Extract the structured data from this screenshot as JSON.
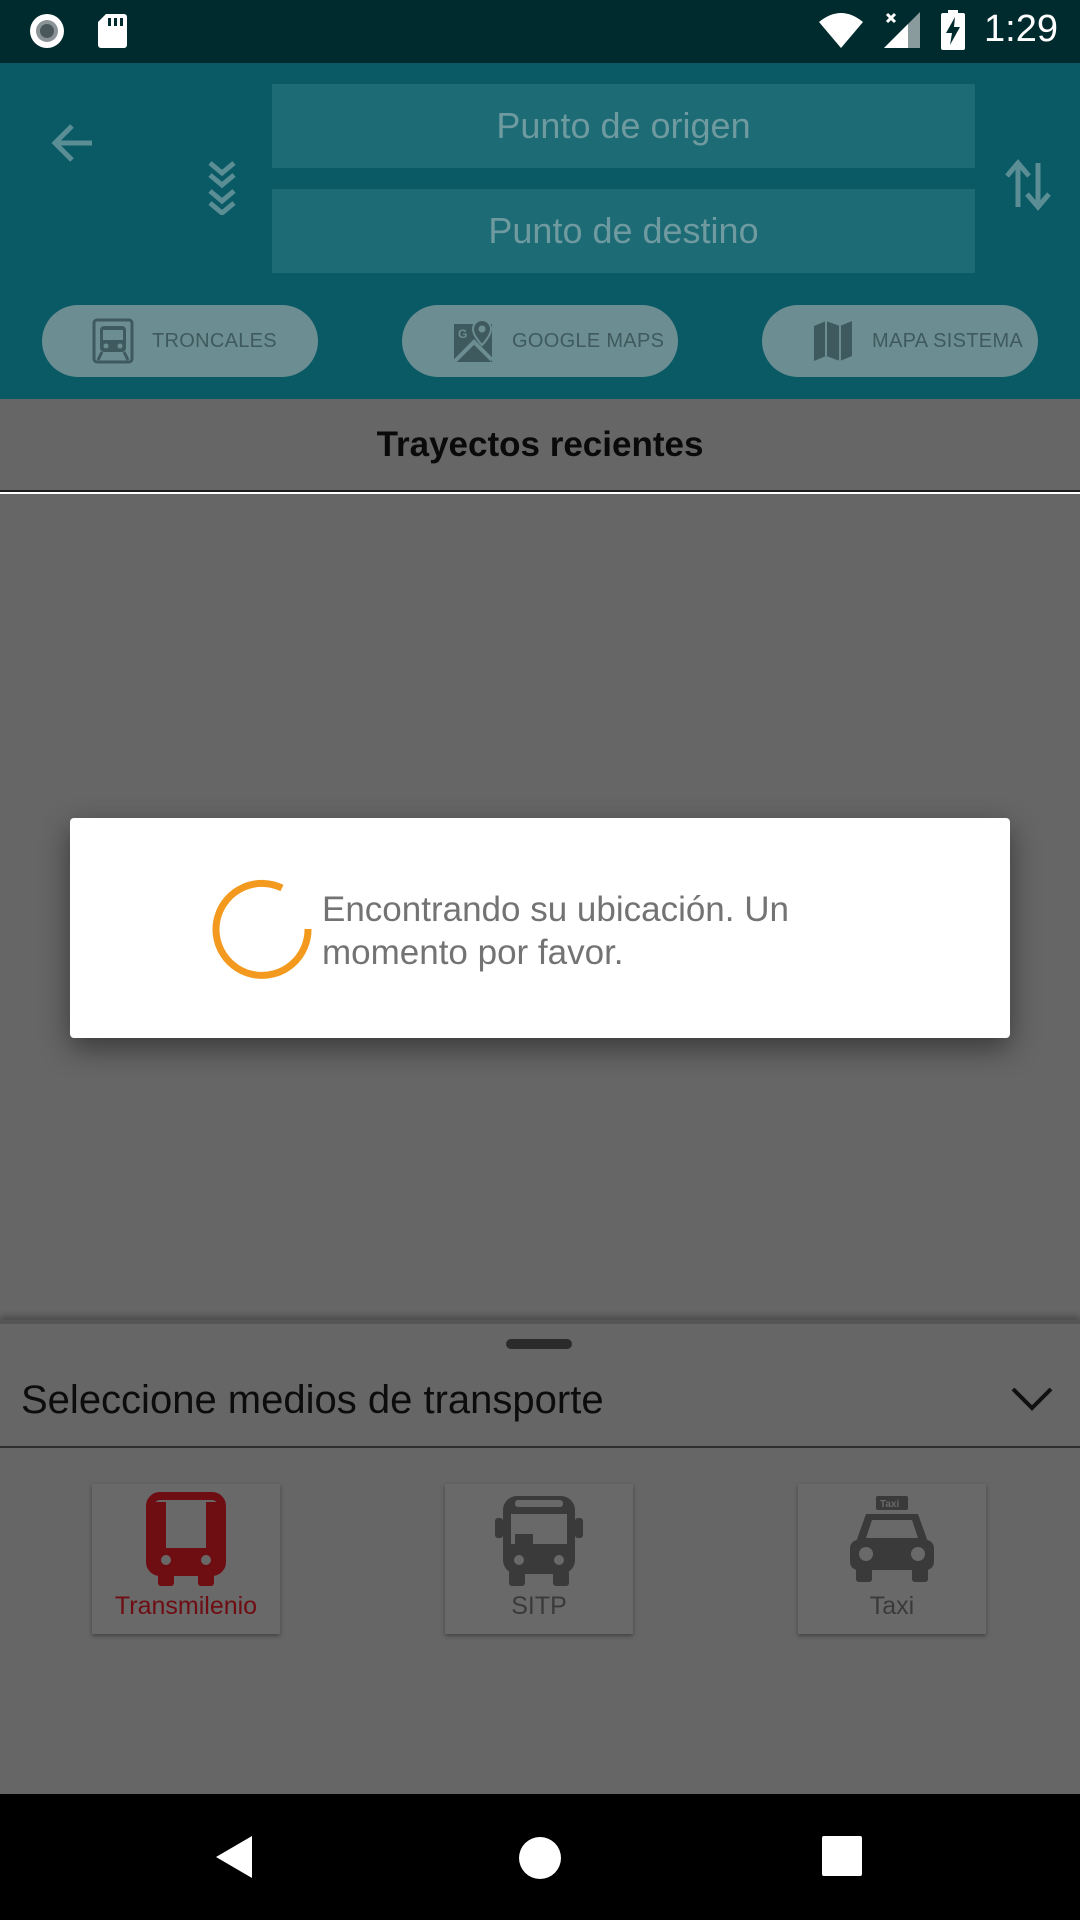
{
  "status_bar": {
    "time": "1:29",
    "icons": [
      "record-icon",
      "sd-card-icon",
      "wifi-icon",
      "signal-icon",
      "battery-charging-icon"
    ]
  },
  "header": {
    "origin_placeholder": "Punto de origen",
    "destination_placeholder": "Punto de destino",
    "chips": [
      {
        "label": "TRONCALES",
        "icon": "train-icon"
      },
      {
        "label": "GOOGLE MAPS",
        "icon": "google-map-icon"
      },
      {
        "label": "MAPA SISTEMA",
        "icon": "map-icon"
      }
    ]
  },
  "recent": {
    "title": "Trayectos recientes"
  },
  "sheet": {
    "title": "Seleccione medios de transporte",
    "modes": [
      {
        "label": "Transmilenio",
        "icon": "bus-icon",
        "selected": true,
        "color": "#6e0d12"
      },
      {
        "label": "SITP",
        "icon": "bus-icon",
        "selected": false
      },
      {
        "label": "Taxi",
        "icon": "taxi-icon",
        "selected": false
      }
    ]
  },
  "dialog": {
    "message": "Encontrando su ubicación. Un momento por favor.",
    "spinner_color": "#f39a1e"
  },
  "colors": {
    "header": "#0a5a66",
    "status_bar": "#002b2e",
    "scrim_gray": "#666666"
  }
}
